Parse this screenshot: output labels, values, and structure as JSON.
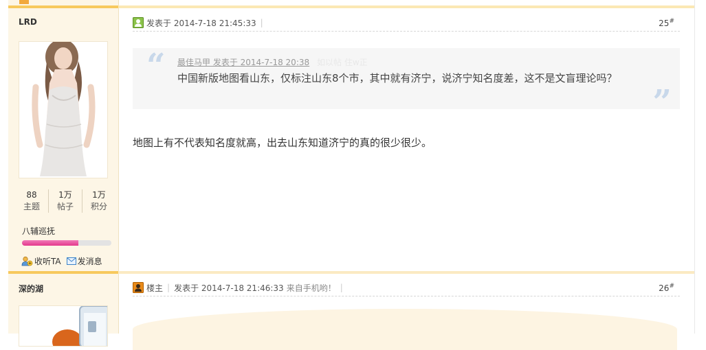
{
  "posts": [
    {
      "author": "LRD",
      "stats": [
        {
          "value": "88",
          "label": "主题"
        },
        {
          "value": "1万",
          "label": "帖子"
        },
        {
          "value": "1万",
          "label": "积分"
        }
      ],
      "rank": "八辅巡抚",
      "rank_progress": 0.63,
      "actions": {
        "follow": "收听TA",
        "message": "发消息"
      },
      "posted": "发表于 2014-7-18 21:45:33",
      "floor": "25",
      "quote": {
        "meta": "最佳马甲 发表于 2014-7-18 20:38",
        "meta_faint": "如以帖 住w正",
        "text": "中国新版地图看山东，仅标注山东8个市，其中就有济宁，说济宁知名度差，这不是文盲理论吗？"
      },
      "body": "地图上有不代表知名度就高，出去山东知道济宁的真的很少很少。"
    },
    {
      "author": "深的湖",
      "role": "楼主",
      "posted": "发表于 2014-7-18 21:46:33",
      "source": "来自手机哟！",
      "floor": "26"
    }
  ],
  "floor_mark": "#",
  "colors": {
    "accent": "#f7c95d",
    "sidebar": "#fdf6e6",
    "rank_bar": "#e4388c"
  }
}
